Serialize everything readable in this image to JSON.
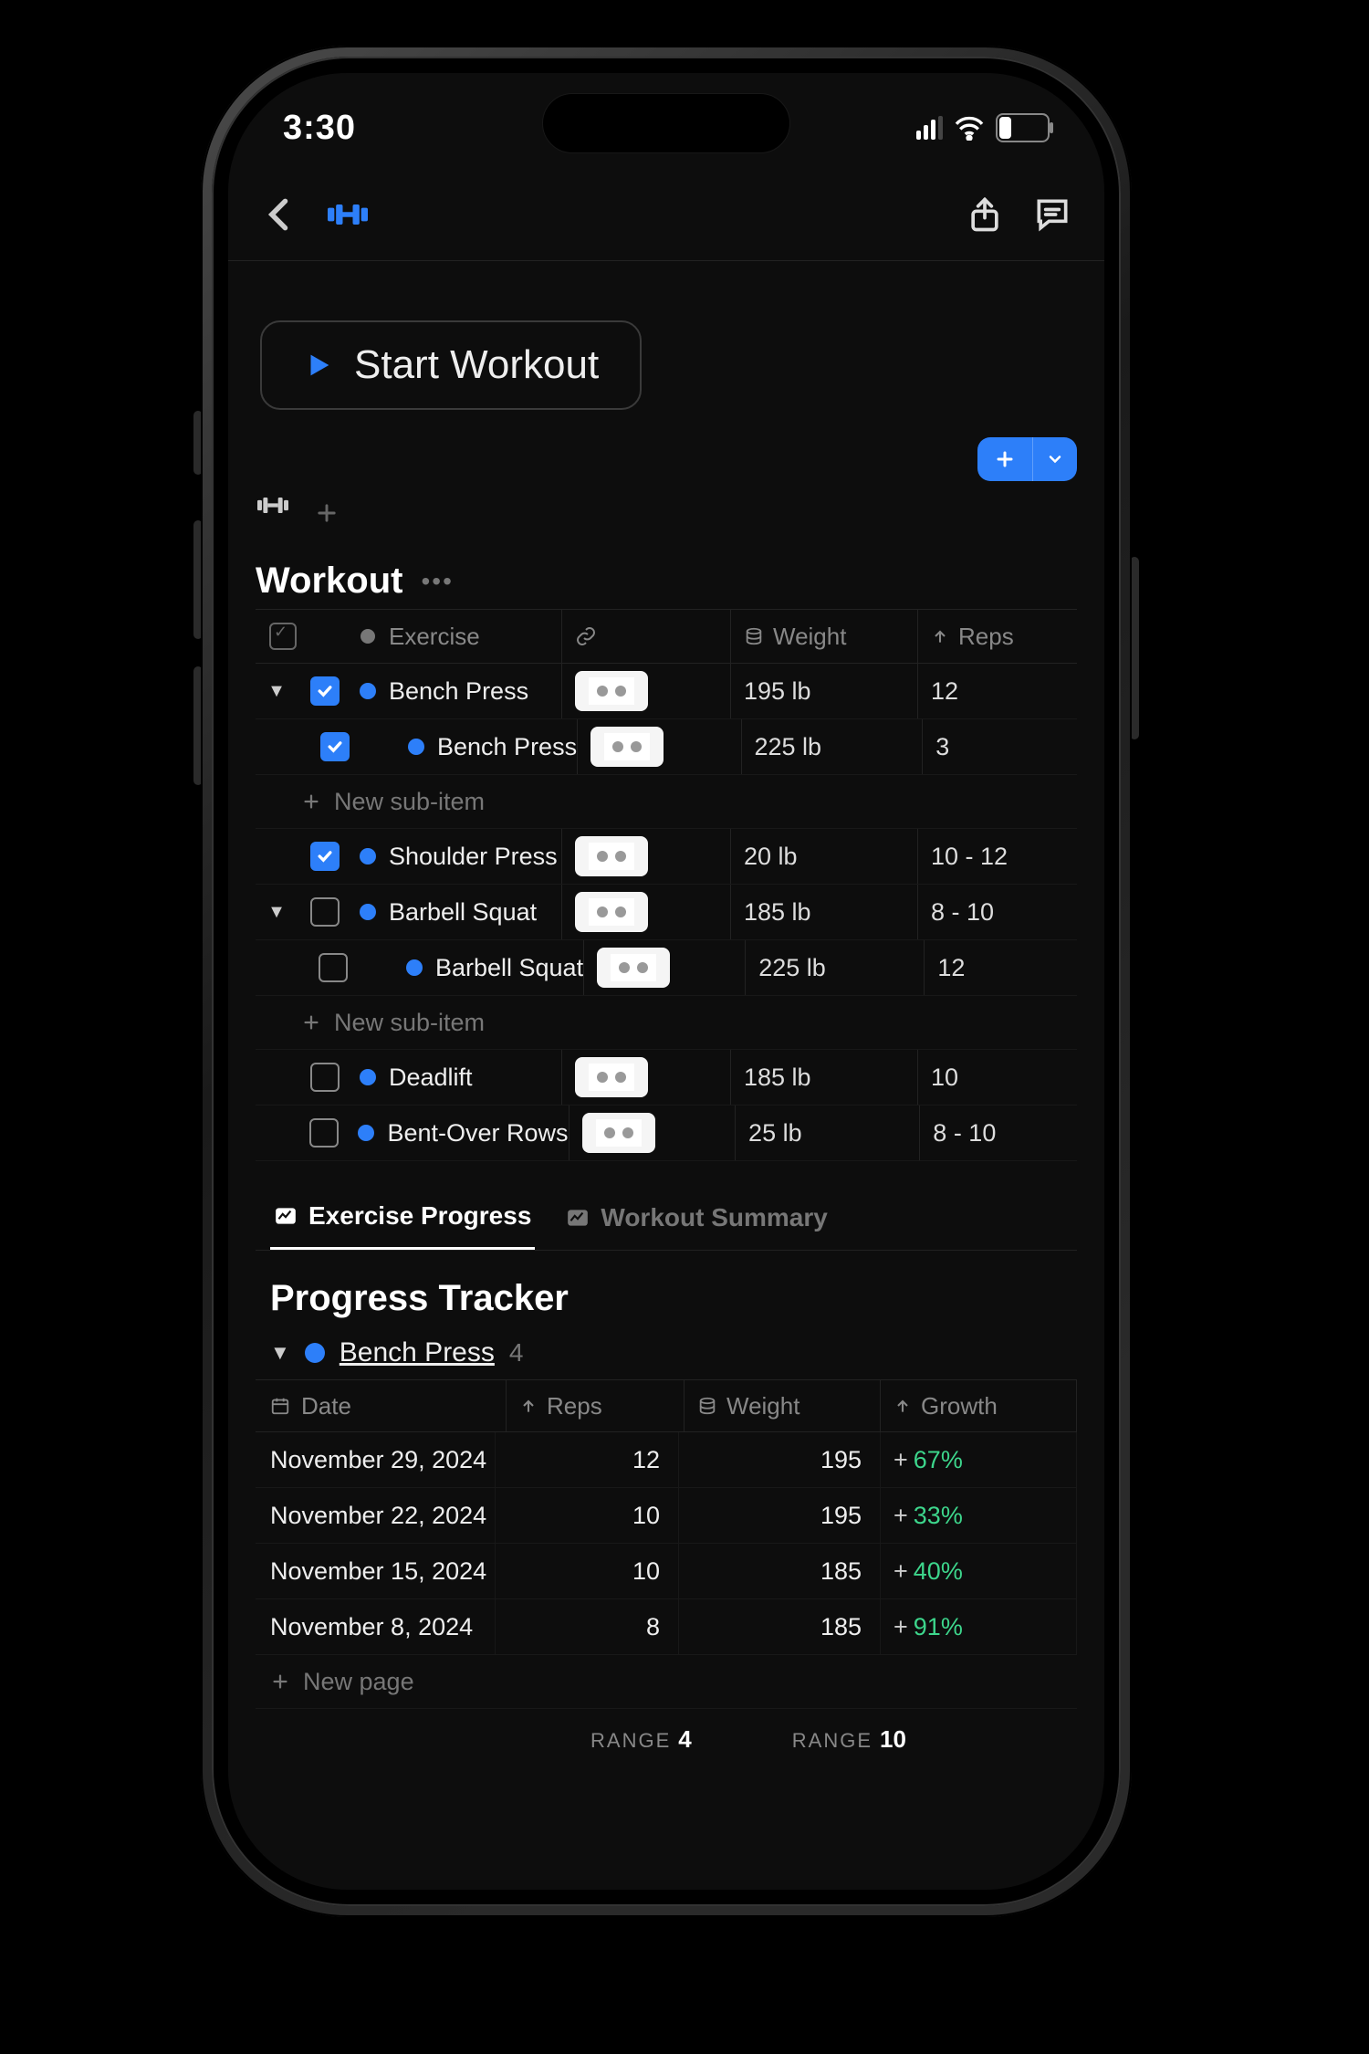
{
  "status": {
    "time": "3:30",
    "battery": "24"
  },
  "main_action": {
    "label": "Start Workout"
  },
  "section": {
    "title": "Workout",
    "new_sub_label": "New sub-item"
  },
  "columns": {
    "exercise": "Exercise",
    "weight": "Weight",
    "reps": "Reps"
  },
  "rows": [
    {
      "checked": true,
      "expandable": true,
      "expanded": true,
      "name": "Bench Press",
      "weight": "195 lb",
      "reps": "12"
    },
    {
      "checked": true,
      "sub": true,
      "name": "Bench Press",
      "weight": "225 lb",
      "reps": "3"
    },
    {
      "newsub": true
    },
    {
      "checked": true,
      "expandable": false,
      "name": "Shoulder Press",
      "weight": "20 lb",
      "reps": "10 - 12"
    },
    {
      "checked": false,
      "expandable": true,
      "expanded": true,
      "name": "Barbell Squat",
      "weight": "185 lb",
      "reps": "8 - 10"
    },
    {
      "checked": false,
      "sub": true,
      "name": "Barbell Squat",
      "weight": "225 lb",
      "reps": "12"
    },
    {
      "newsub": true
    },
    {
      "checked": false,
      "expandable": false,
      "name": "Deadlift",
      "weight": "185 lb",
      "reps": "10"
    },
    {
      "checked": false,
      "expandable": false,
      "name": "Bent-Over Rows",
      "weight": "25 lb",
      "reps": "8 - 10"
    }
  ],
  "tabs": {
    "progress": "Exercise Progress",
    "summary": "Workout Summary"
  },
  "tracker": {
    "title": "Progress Tracker",
    "group_name": "Bench Press",
    "group_count": "4",
    "columns": {
      "date": "Date",
      "reps": "Reps",
      "weight": "Weight",
      "growth": "Growth"
    },
    "rows": [
      {
        "date": "November 29, 2024",
        "reps": "12",
        "weight": "195",
        "growth": "67%"
      },
      {
        "date": "November 22, 2024",
        "reps": "10",
        "weight": "195",
        "growth": "33%"
      },
      {
        "date": "November 15, 2024",
        "reps": "10",
        "weight": "185",
        "growth": "40%"
      },
      {
        "date": "November 8, 2024",
        "reps": "8",
        "weight": "185",
        "growth": "91%"
      }
    ],
    "new_page": "New page",
    "range1_label": "RANGE",
    "range1_value": "4",
    "range2_label": "RANGE",
    "range2_value": "10"
  }
}
